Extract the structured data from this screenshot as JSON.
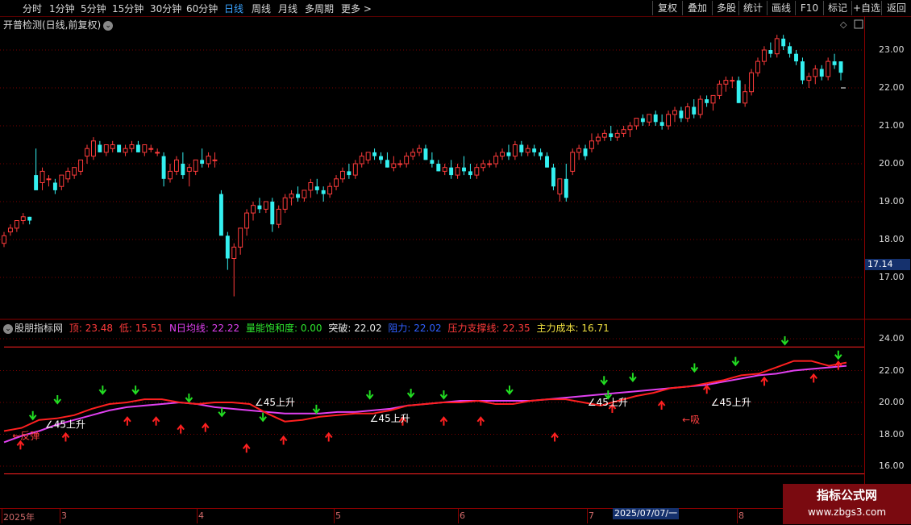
{
  "toolbar": {
    "periods": [
      "分时",
      "1分钟",
      "5分钟",
      "15分钟",
      "30分钟",
      "60分钟",
      "日线",
      "周线",
      "月线",
      "多周期",
      "更多 >"
    ],
    "active_period": "日线",
    "tools": [
      "复权",
      "叠加",
      "多股",
      "统计",
      "画线",
      "F10",
      "标记",
      "+自选",
      "返回"
    ]
  },
  "main_chart": {
    "title": "开普检测(日线,前复权)",
    "y_ticks": [
      "23.00",
      "22.00",
      "21.00",
      "20.00",
      "19.00",
      "18.00",
      "17.00"
    ],
    "price_marker": "17.14",
    "candles": [
      [
        17.9,
        18.2,
        17.8,
        18.1
      ],
      [
        18.2,
        18.4,
        18.1,
        18.3
      ],
      [
        18.3,
        18.5,
        18.2,
        18.5
      ],
      [
        18.5,
        18.7,
        18.4,
        18.6
      ],
      [
        18.6,
        18.6,
        18.4,
        18.5
      ],
      [
        19.7,
        20.4,
        19.3,
        19.3
      ],
      [
        19.5,
        19.9,
        19.3,
        19.8
      ],
      [
        19.6,
        19.7,
        19.4,
        19.6
      ],
      [
        19.5,
        19.6,
        19.2,
        19.3
      ],
      [
        19.4,
        19.7,
        19.3,
        19.7
      ],
      [
        19.6,
        19.9,
        19.5,
        19.8
      ],
      [
        19.7,
        19.9,
        19.6,
        19.9
      ],
      [
        19.8,
        20.1,
        19.7,
        20.1
      ],
      [
        20.2,
        20.5,
        20.0,
        20.4
      ],
      [
        20.2,
        20.7,
        20.1,
        20.6
      ],
      [
        20.5,
        20.6,
        20.3,
        20.3
      ],
      [
        20.3,
        20.5,
        20.2,
        20.5
      ],
      [
        20.4,
        20.6,
        20.3,
        20.5
      ],
      [
        20.5,
        20.5,
        20.3,
        20.3
      ],
      [
        20.3,
        20.5,
        20.2,
        20.4
      ],
      [
        20.4,
        20.6,
        20.3,
        20.5
      ],
      [
        20.5,
        20.6,
        20.3,
        20.3
      ],
      [
        20.3,
        20.5,
        20.2,
        20.5
      ],
      [
        20.4,
        20.5,
        20.3,
        20.4
      ],
      [
        20.3,
        20.4,
        20.2,
        20.3
      ],
      [
        20.2,
        20.3,
        19.4,
        19.6
      ],
      [
        19.6,
        20.0,
        19.5,
        19.8
      ],
      [
        19.8,
        20.2,
        19.7,
        20.1
      ],
      [
        20.0,
        20.3,
        19.6,
        19.7
      ],
      [
        19.8,
        20.0,
        19.4,
        19.9
      ],
      [
        19.8,
        20.0,
        19.7,
        20.1
      ],
      [
        20.1,
        20.4,
        19.9,
        20.0
      ],
      [
        20.0,
        20.3,
        19.9,
        20.2
      ],
      [
        20.1,
        20.3,
        19.9,
        20.1
      ],
      [
        19.2,
        19.3,
        18.2,
        18.1
      ],
      [
        18.1,
        18.2,
        17.2,
        17.5
      ],
      [
        17.5,
        17.9,
        16.5,
        17.8
      ],
      [
        17.8,
        18.3,
        17.6,
        18.3
      ],
      [
        18.3,
        18.8,
        18.1,
        18.7
      ],
      [
        18.7,
        19.0,
        18.5,
        18.9
      ],
      [
        18.9,
        19.1,
        18.7,
        18.8
      ],
      [
        18.8,
        19.0,
        18.7,
        19.0
      ],
      [
        19.0,
        19.1,
        18.2,
        18.4
      ],
      [
        18.4,
        18.9,
        18.3,
        18.8
      ],
      [
        18.8,
        19.2,
        18.7,
        19.1
      ],
      [
        19.1,
        19.3,
        18.9,
        19.2
      ],
      [
        19.2,
        19.4,
        19.0,
        19.1
      ],
      [
        19.1,
        19.3,
        19.0,
        19.3
      ],
      [
        19.3,
        19.6,
        19.1,
        19.5
      ],
      [
        19.4,
        19.6,
        19.2,
        19.3
      ],
      [
        19.3,
        19.4,
        19.0,
        19.2
      ],
      [
        19.2,
        19.5,
        19.1,
        19.4
      ],
      [
        19.4,
        19.7,
        19.3,
        19.6
      ],
      [
        19.6,
        19.9,
        19.5,
        19.8
      ],
      [
        19.8,
        20.0,
        19.6,
        19.7
      ],
      [
        19.7,
        20.1,
        19.6,
        20.0
      ],
      [
        20.0,
        20.3,
        19.9,
        20.2
      ],
      [
        20.1,
        20.3,
        20.0,
        20.3
      ],
      [
        20.3,
        20.4,
        20.1,
        20.2
      ],
      [
        20.2,
        20.3,
        20.0,
        20.1
      ],
      [
        20.1,
        20.3,
        19.9,
        19.9
      ],
      [
        19.9,
        20.2,
        19.8,
        20.0
      ],
      [
        20.0,
        20.1,
        19.9,
        20.0
      ],
      [
        20.0,
        20.3,
        19.9,
        20.2
      ],
      [
        20.2,
        20.4,
        20.1,
        20.3
      ],
      [
        20.3,
        20.5,
        20.2,
        20.4
      ],
      [
        20.4,
        20.5,
        20.1,
        20.1
      ],
      [
        20.1,
        20.3,
        19.9,
        20.0
      ],
      [
        20.0,
        20.1,
        19.8,
        19.8
      ],
      [
        19.8,
        20.0,
        19.7,
        19.9
      ],
      [
        19.9,
        20.1,
        19.6,
        19.7
      ],
      [
        19.7,
        20.0,
        19.6,
        19.9
      ],
      [
        19.9,
        20.2,
        19.7,
        19.8
      ],
      [
        19.8,
        20.0,
        19.6,
        19.7
      ],
      [
        19.7,
        20.0,
        19.6,
        19.9
      ],
      [
        19.9,
        20.1,
        19.8,
        20.0
      ],
      [
        20.0,
        20.1,
        19.9,
        20.0
      ],
      [
        20.0,
        20.3,
        19.9,
        20.2
      ],
      [
        20.2,
        20.4,
        20.1,
        20.3
      ],
      [
        20.3,
        20.5,
        20.1,
        20.2
      ],
      [
        20.2,
        20.6,
        20.1,
        20.5
      ],
      [
        20.5,
        20.6,
        20.2,
        20.3
      ],
      [
        20.3,
        20.5,
        20.2,
        20.4
      ],
      [
        20.4,
        20.5,
        20.2,
        20.3
      ],
      [
        20.3,
        20.4,
        20.1,
        20.2
      ],
      [
        20.2,
        20.3,
        19.9,
        19.9
      ],
      [
        19.9,
        20.0,
        19.3,
        19.4
      ],
      [
        19.2,
        19.6,
        19.0,
        19.6
      ],
      [
        19.6,
        20.0,
        19.0,
        19.1
      ],
      [
        19.8,
        20.4,
        19.7,
        20.3
      ],
      [
        20.3,
        20.5,
        20.1,
        20.4
      ],
      [
        20.4,
        20.5,
        20.1,
        20.2
      ],
      [
        20.4,
        20.8,
        20.3,
        20.6
      ],
      [
        20.6,
        20.8,
        20.5,
        20.7
      ],
      [
        20.7,
        20.9,
        20.6,
        20.8
      ],
      [
        20.8,
        21.0,
        20.6,
        20.7
      ],
      [
        20.7,
        20.9,
        20.6,
        20.8
      ],
      [
        20.8,
        21.0,
        20.7,
        20.9
      ],
      [
        20.9,
        21.1,
        20.7,
        21.0
      ],
      [
        21.0,
        21.2,
        20.9,
        21.2
      ],
      [
        21.2,
        21.3,
        21.0,
        21.1
      ],
      [
        21.1,
        21.3,
        21.0,
        21.3
      ],
      [
        21.3,
        21.4,
        21.0,
        21.1
      ],
      [
        21.1,
        21.3,
        20.9,
        21.0
      ],
      [
        21.0,
        21.4,
        20.9,
        21.3
      ],
      [
        21.3,
        21.5,
        21.1,
        21.4
      ],
      [
        21.4,
        21.5,
        21.1,
        21.2
      ],
      [
        21.2,
        21.6,
        21.1,
        21.5
      ],
      [
        21.5,
        21.7,
        21.2,
        21.3
      ],
      [
        21.3,
        21.8,
        21.2,
        21.7
      ],
      [
        21.7,
        21.8,
        21.5,
        21.6
      ],
      [
        21.6,
        21.8,
        21.4,
        21.8
      ],
      [
        21.8,
        22.2,
        21.7,
        22.1
      ],
      [
        22.1,
        22.3,
        21.9,
        22.2
      ],
      [
        22.2,
        22.3,
        22.0,
        22.2
      ],
      [
        22.2,
        22.3,
        21.6,
        21.6
      ],
      [
        21.6,
        22.1,
        21.5,
        21.9
      ],
      [
        21.9,
        22.5,
        21.8,
        22.4
      ],
      [
        22.4,
        22.8,
        22.3,
        22.7
      ],
      [
        22.7,
        23.1,
        22.6,
        23.0
      ],
      [
        23.0,
        23.2,
        22.8,
        22.9
      ],
      [
        22.9,
        23.4,
        22.8,
        23.3
      ],
      [
        23.3,
        23.4,
        23.0,
        23.1
      ],
      [
        23.1,
        23.2,
        22.8,
        22.9
      ],
      [
        22.9,
        23.0,
        22.6,
        22.7
      ],
      [
        22.7,
        22.8,
        22.1,
        22.2
      ],
      [
        22.2,
        22.4,
        22.0,
        22.3
      ],
      [
        22.3,
        22.6,
        22.1,
        22.5
      ],
      [
        22.5,
        22.6,
        22.2,
        22.3
      ],
      [
        22.3,
        22.8,
        22.2,
        22.7
      ],
      [
        22.7,
        22.9,
        22.5,
        22.6
      ],
      [
        22.7,
        22.7,
        22.2,
        22.4
      ]
    ]
  },
  "indicator": {
    "name": "股朋指标网",
    "top_label": "顶: 23.48",
    "low_label": "低: 15.51",
    "ma_label": "N日均线: 22.22",
    "vol_label": "量能饱和度: 0.00",
    "break_label": "突破: 22.02",
    "resist_label": "阻力: 22.02",
    "support_label": "压力支撑线: 22.35",
    "cost_label": "主力成本: 16.71",
    "y_ticks": [
      "24.00",
      "22.00",
      "20.00",
      "18.00",
      "16.00"
    ],
    "text_labels": [
      {
        "text": "∠45上升",
        "series_x": 10,
        "v": 18.6
      },
      {
        "text": "∠45上升",
        "series_x": 61,
        "v": 20.0
      },
      {
        "text": "∠45上升",
        "series_x": 89,
        "v": 19.0
      },
      {
        "text": "∠45上升",
        "series_x": 142,
        "v": 20.0
      },
      {
        "text": "∠45上升",
        "series_x": 172,
        "v": 20.0
      },
      {
        "text": "←吸",
        "series_x": 165,
        "v": 18.9
      },
      {
        "text": "←反弹",
        "series_x": 2,
        "v": 17.9
      },
      {
        "text": "←反弹",
        "series_x": 248,
        "v": 22.2
      }
    ],
    "red_line": [
      18.2,
      18.4,
      18.9,
      19.0,
      19.2,
      19.6,
      19.9,
      20.0,
      20.2,
      20.2,
      20.0,
      19.9,
      20.0,
      20.0,
      19.9,
      19.3,
      18.8,
      18.9,
      19.1,
      19.2,
      19.3,
      19.3,
      19.5,
      19.8,
      19.9,
      20.0,
      20.0,
      20.1,
      19.9,
      19.9,
      20.1,
      20.2,
      20.2,
      20.0,
      19.8,
      20.1,
      20.4,
      20.6,
      20.9,
      21.0,
      21.2,
      21.4,
      21.7,
      21.8,
      22.2,
      22.6,
      22.6,
      22.3,
      22.5
    ],
    "pink_line": [
      17.5,
      17.9,
      18.2,
      18.6,
      18.9,
      19.2,
      19.5,
      19.7,
      19.8,
      19.9,
      20.0,
      19.9,
      19.7,
      19.6,
      19.5,
      19.4,
      19.3,
      19.3,
      19.3,
      19.4,
      19.4,
      19.5,
      19.6,
      19.8,
      19.9,
      20.0,
      20.1,
      20.1,
      20.1,
      20.1,
      20.1,
      20.2,
      20.3,
      20.4,
      20.5,
      20.6,
      20.7,
      20.8,
      20.9,
      21.0,
      21.1,
      21.3,
      21.5,
      21.7,
      21.8,
      22.0,
      22.1,
      22.2,
      22.3
    ],
    "green_arrows": [
      [
        7,
        19.0
      ],
      [
        13,
        20.0
      ],
      [
        24,
        20.6
      ],
      [
        32,
        20.6
      ],
      [
        45,
        20.1
      ],
      [
        53,
        19.2
      ],
      [
        63,
        18.9
      ],
      [
        76,
        19.4
      ],
      [
        89,
        20.3
      ],
      [
        99,
        20.4
      ],
      [
        107,
        20.3
      ],
      [
        123,
        20.6
      ],
      [
        147,
        20.3
      ],
      [
        146,
        21.2
      ],
      [
        153,
        21.4
      ],
      [
        168,
        22.0
      ],
      [
        178,
        22.4
      ],
      [
        190,
        23.7
      ],
      [
        203,
        22.8
      ]
    ],
    "red_arrows": [
      [
        4,
        17.5
      ],
      [
        15,
        18.0
      ],
      [
        30,
        19.0
      ],
      [
        37,
        19.0
      ],
      [
        43,
        18.5
      ],
      [
        49,
        18.6
      ],
      [
        59,
        17.3
      ],
      [
        68,
        17.8
      ],
      [
        79,
        18.0
      ],
      [
        97,
        19.0
      ],
      [
        107,
        19.0
      ],
      [
        116,
        19.0
      ],
      [
        134,
        18.0
      ],
      [
        148,
        19.8
      ],
      [
        160,
        20.0
      ],
      [
        171,
        21.0
      ],
      [
        185,
        21.5
      ],
      [
        197,
        21.7
      ],
      [
        203,
        22.5
      ]
    ],
    "upper_bound": 23.48,
    "lower_bound": 15.51
  },
  "x_axis": {
    "labels": [
      "2025年",
      "3",
      "4",
      "5",
      "6",
      "7",
      "8"
    ],
    "cursor_date": "2025/07/07/一"
  },
  "watermark": {
    "title": "指标公式网",
    "url": "www.zbgs3.com"
  },
  "colors": {
    "up": "#ff3b3b",
    "down": "#34f0f0",
    "ma_pink": "#e040f0",
    "grid": "#7a0000",
    "accent_blue": "#3aa3ff"
  }
}
